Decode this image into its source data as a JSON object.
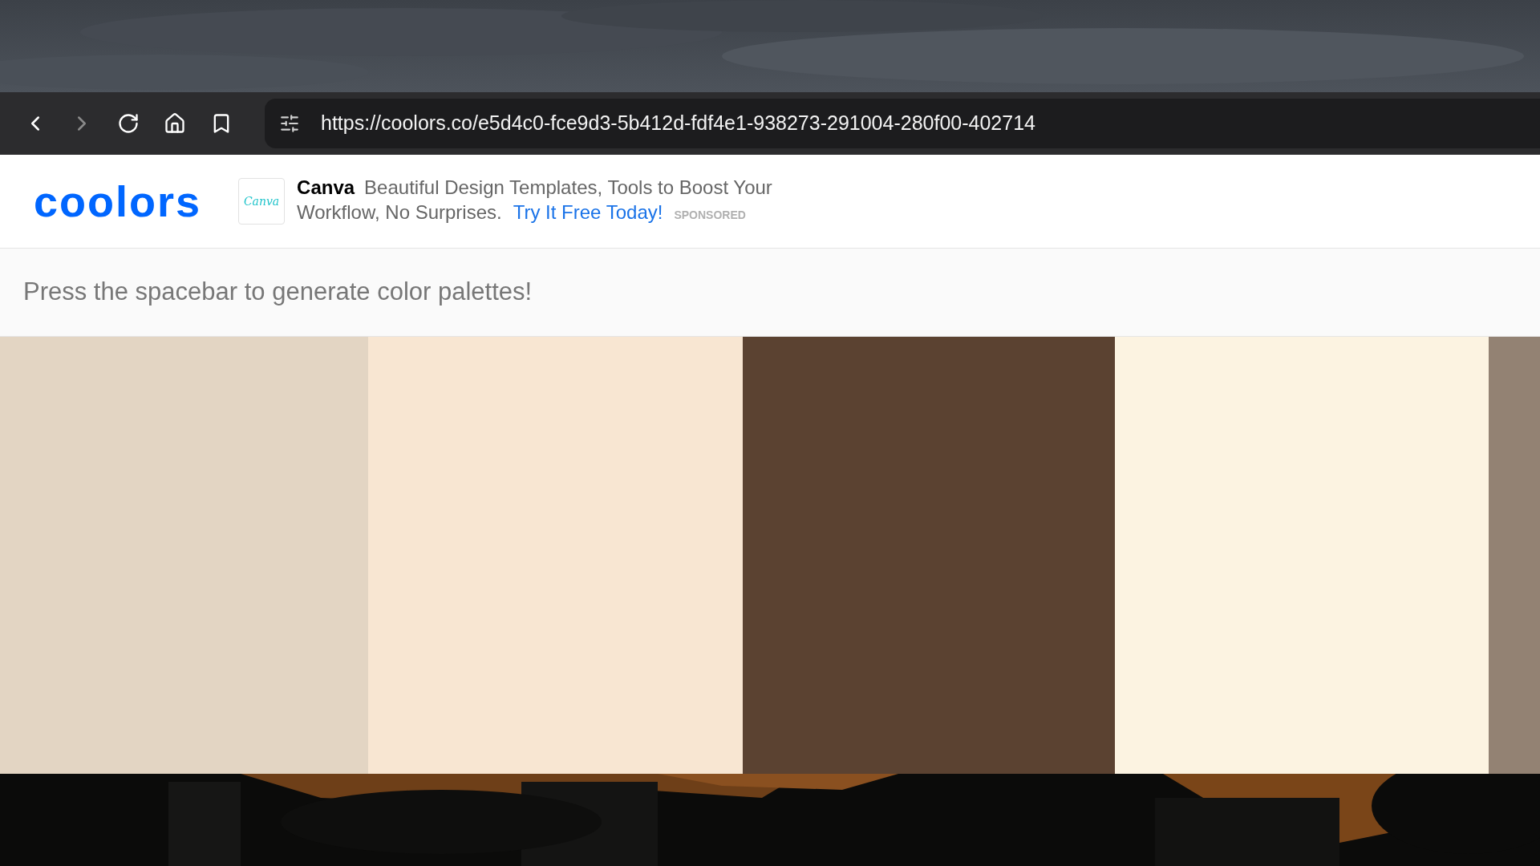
{
  "browser": {
    "url": "https://coolors.co/e5d4c0-fce9d3-5b412d-fdf4e1-938273-291004-280f00-402714",
    "forward_disabled": true
  },
  "header": {
    "logo": "coolors",
    "ad": {
      "icon_text": "Canva",
      "brand": "Canva",
      "text_1": "Beautiful Design Templates, Tools to Boost Your",
      "text_2": "Workflow, No Surprises.",
      "link": "Try It Free Today!",
      "badge": "SPONSORED"
    }
  },
  "hint": "Press the spacebar to generate color palettes!",
  "palette": [
    {
      "color": "#e3d5c3"
    },
    {
      "color": "#f8e6d2"
    },
    {
      "color": "#5b4231"
    },
    {
      "color": "#fcf3e1"
    },
    {
      "color": "#938273"
    }
  ]
}
